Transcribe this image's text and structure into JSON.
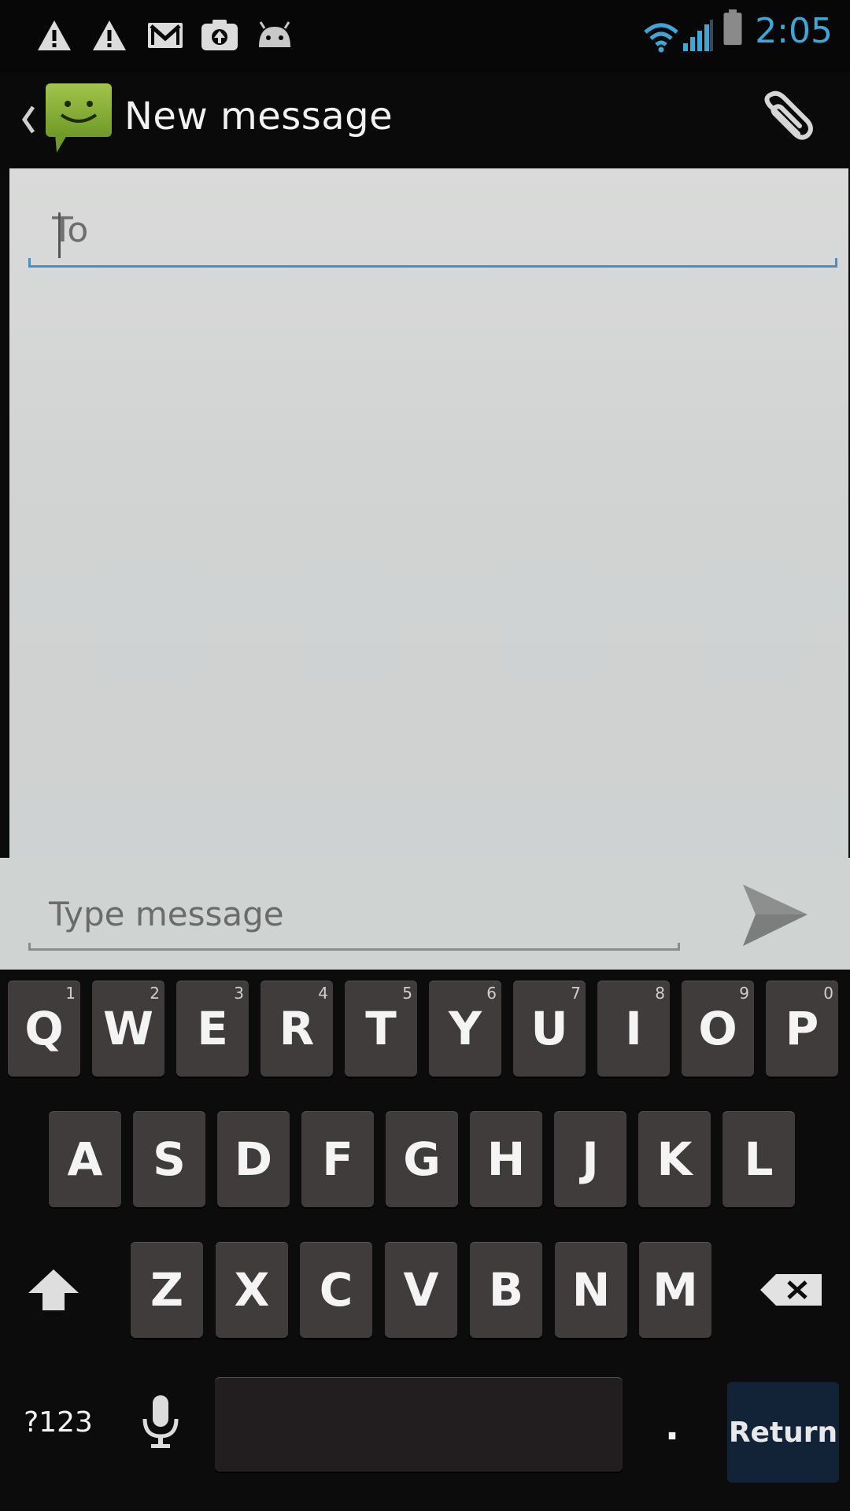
{
  "status_bar": {
    "time": "2:05",
    "icons": [
      "warning-icon",
      "warning-icon",
      "gmail-icon",
      "camera-icon",
      "android-icon",
      "wifi-icon",
      "signal-icon",
      "battery-icon"
    ]
  },
  "action_bar": {
    "title": "New message",
    "app_icon": "messaging-icon",
    "attach_icon": "paperclip-icon"
  },
  "compose": {
    "to_placeholder": "To",
    "message_placeholder": "Type message",
    "send_icon": "send-icon"
  },
  "keyboard": {
    "row1": [
      {
        "label": "Q",
        "hint": "1"
      },
      {
        "label": "W",
        "hint": "2"
      },
      {
        "label": "E",
        "hint": "3"
      },
      {
        "label": "R",
        "hint": "4"
      },
      {
        "label": "T",
        "hint": "5"
      },
      {
        "label": "Y",
        "hint": "6"
      },
      {
        "label": "U",
        "hint": "7"
      },
      {
        "label": "I",
        "hint": "8"
      },
      {
        "label": "O",
        "hint": "9"
      },
      {
        "label": "P",
        "hint": "0"
      }
    ],
    "row2": [
      "A",
      "S",
      "D",
      "F",
      "G",
      "H",
      "J",
      "K",
      "L"
    ],
    "row3": [
      "Z",
      "X",
      "C",
      "V",
      "B",
      "N",
      "M"
    ],
    "symbols_label": "?123",
    "period_label": ".",
    "return_label": "Return"
  },
  "colors": {
    "accent": "#3fa6d8",
    "underline": "#4a8fbf",
    "key": "#3f3c3b",
    "return_key": "#122338",
    "app_icon_green": "#8fb43a"
  }
}
